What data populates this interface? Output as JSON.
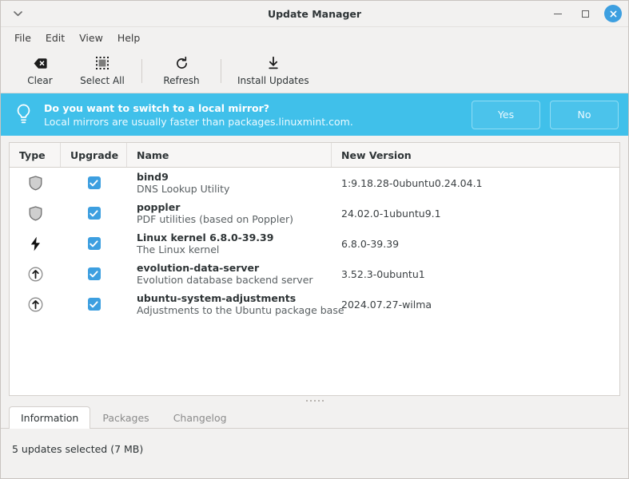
{
  "window": {
    "title": "Update Manager",
    "menu_chevron_icon": "chevron-down-icon",
    "minimize_icon": "minimize-icon",
    "maximize_icon": "maximize-icon",
    "close_icon": "close-icon"
  },
  "menubar": {
    "items": [
      {
        "label": "File"
      },
      {
        "label": "Edit"
      },
      {
        "label": "View"
      },
      {
        "label": "Help"
      }
    ]
  },
  "toolbar": {
    "buttons": [
      {
        "label": "Clear",
        "icon": "clear-icon"
      },
      {
        "label": "Select All",
        "icon": "select-all-icon"
      },
      {
        "label": "Refresh",
        "icon": "refresh-icon"
      },
      {
        "label": "Install Updates",
        "icon": "install-updates-icon"
      }
    ]
  },
  "infobar": {
    "icon": "lightbulb-icon",
    "title": "Do you want to switch to a local mirror?",
    "subtitle": "Local mirrors are usually faster than packages.linuxmint.com.",
    "yes_label": "Yes",
    "no_label": "No",
    "background_color": "#40c0ea"
  },
  "updates_table": {
    "columns": [
      {
        "key": "type",
        "label": "Type"
      },
      {
        "key": "upgrade",
        "label": "Upgrade"
      },
      {
        "key": "name",
        "label": "Name"
      },
      {
        "key": "version",
        "label": "New Version"
      }
    ],
    "rows": [
      {
        "type_icon": "shield-icon",
        "checked": true,
        "name": "bind9",
        "description": "DNS Lookup Utility",
        "version": "1:9.18.28-0ubuntu0.24.04.1"
      },
      {
        "type_icon": "shield-icon",
        "checked": true,
        "name": "poppler",
        "description": "PDF utilities (based on Poppler)",
        "version": "24.02.0-1ubuntu9.1"
      },
      {
        "type_icon": "lightning-bolt-icon",
        "checked": true,
        "name": "Linux kernel 6.8.0-39.39",
        "description": "The Linux kernel",
        "version": "6.8.0-39.39"
      },
      {
        "type_icon": "arrow-up-circle-icon",
        "checked": true,
        "name": "evolution-data-server",
        "description": "Evolution database backend server",
        "version": "3.52.3-0ubuntu1"
      },
      {
        "type_icon": "arrow-up-circle-icon",
        "checked": true,
        "name": "ubuntu-system-adjustments",
        "description": "Adjustments to the Ubuntu package base",
        "version": "2024.07.27-wilma"
      }
    ]
  },
  "bottom_tabs": {
    "tabs": [
      {
        "label": "Information",
        "active": true
      },
      {
        "label": "Packages",
        "active": false
      },
      {
        "label": "Changelog",
        "active": false
      }
    ]
  },
  "statusbar": {
    "text": "5 updates selected (7 MB)"
  },
  "colors": {
    "accent": "#3d9fe0",
    "infobar": "#40c0ea",
    "window_bg": "#f2f1f0"
  }
}
